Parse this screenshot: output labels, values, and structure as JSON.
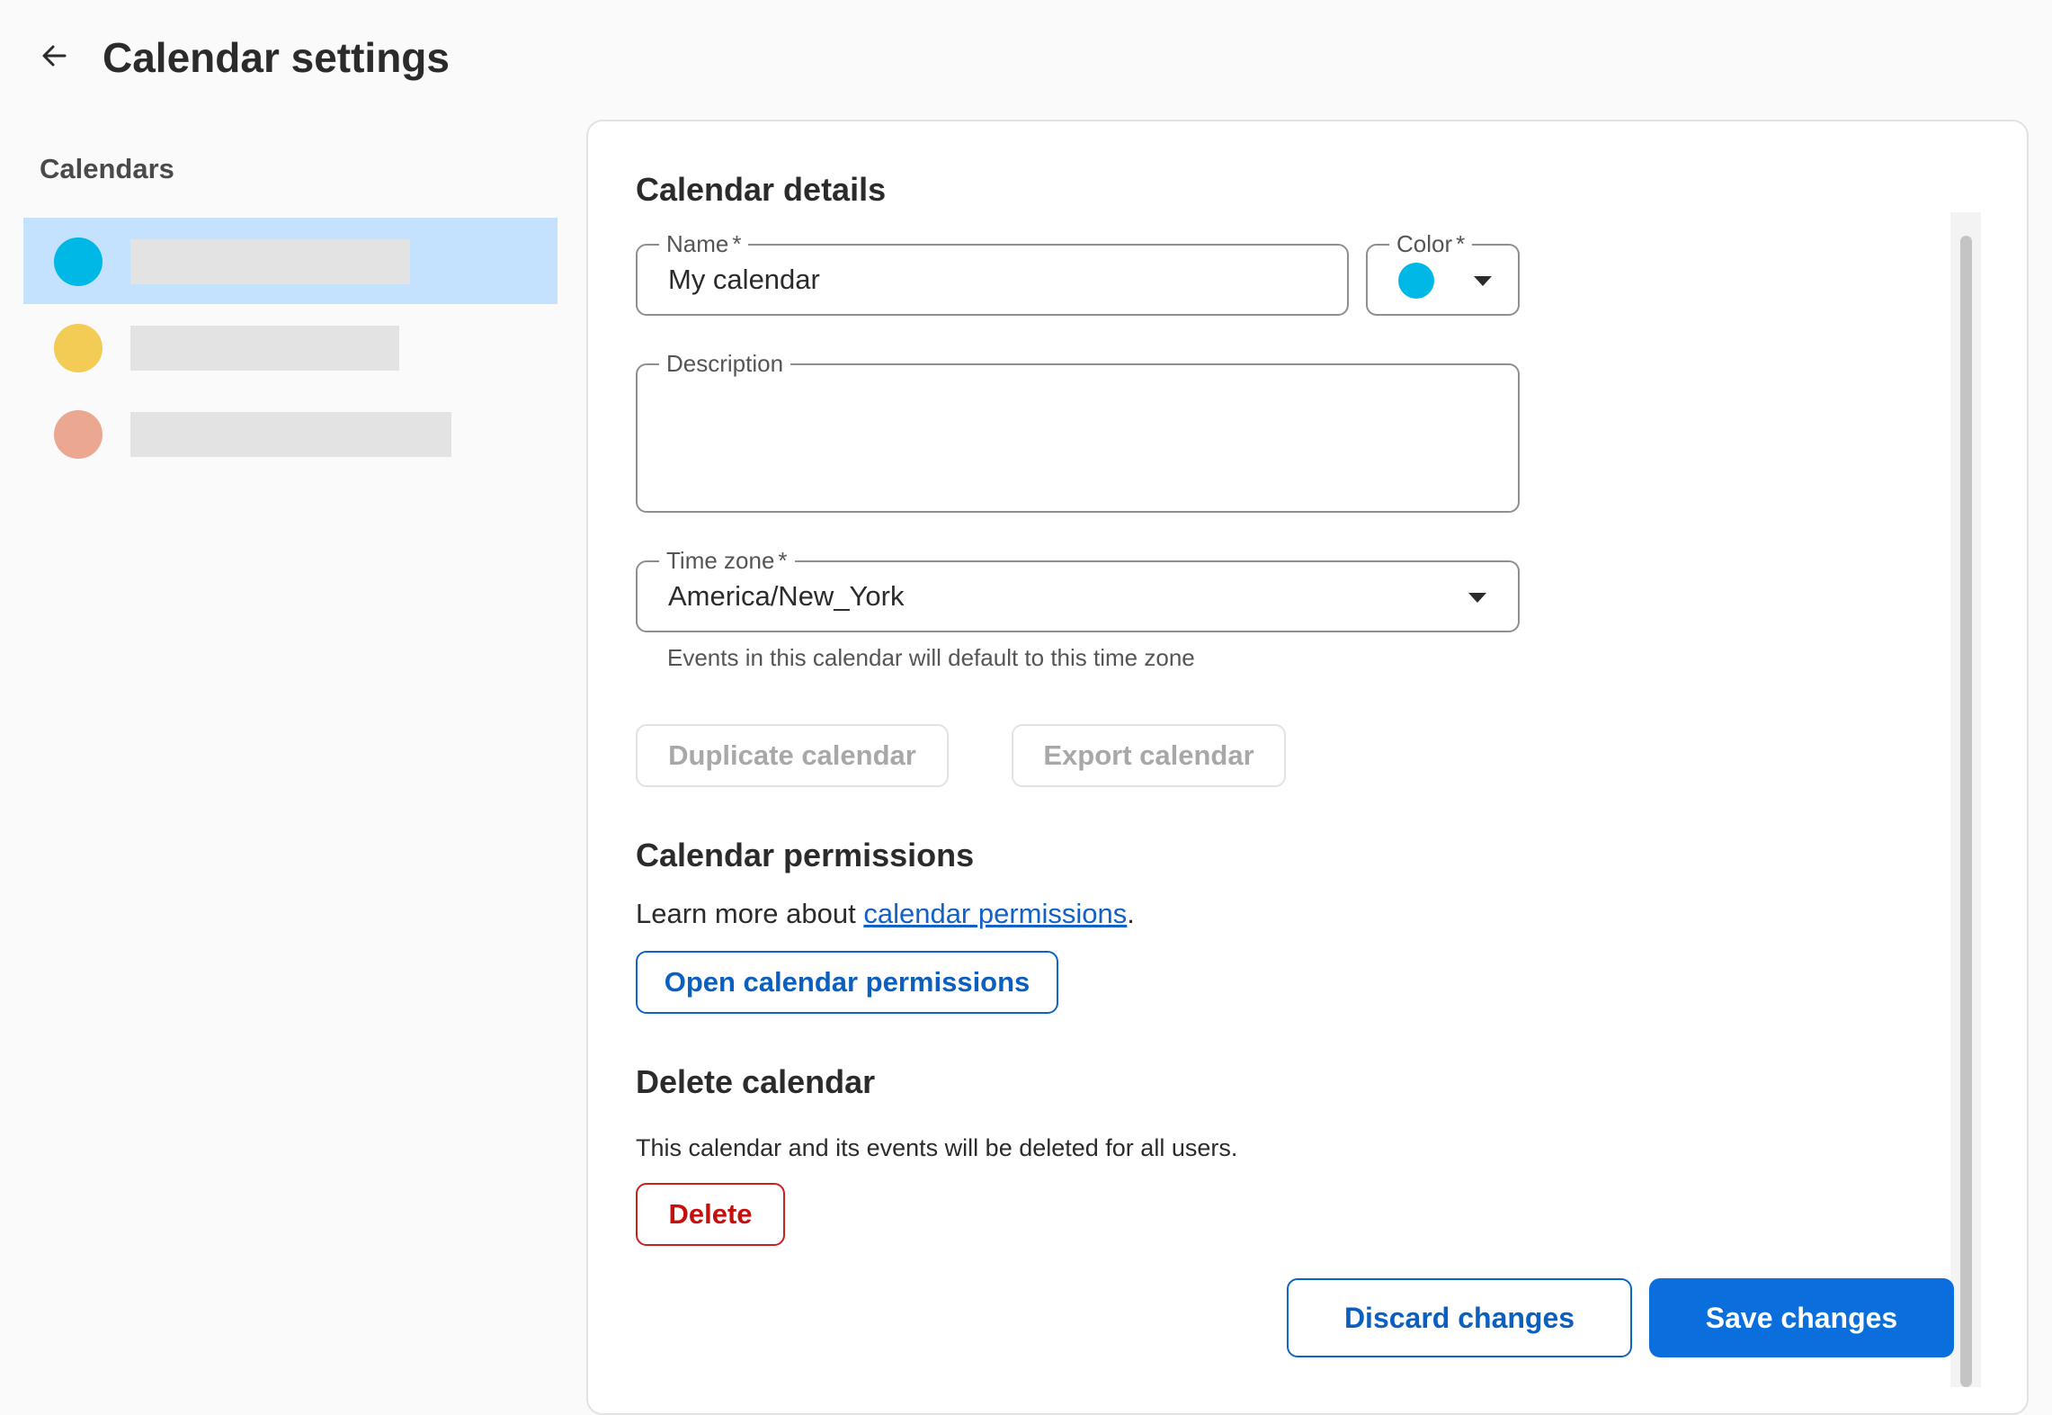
{
  "header": {
    "title": "Calendar settings",
    "back_icon": "arrow-left-icon"
  },
  "sidebar": {
    "heading": "Calendars",
    "items": [
      {
        "color": "#00b8e6",
        "selected": true
      },
      {
        "color": "#f2cc55",
        "selected": false
      },
      {
        "color": "#eba790",
        "selected": false
      }
    ]
  },
  "details": {
    "title": "Calendar details",
    "name_label": "Name",
    "name_value": "My calendar",
    "color_label": "Color",
    "color_value": "#00b8e6",
    "required_marker": "*",
    "description_label": "Description",
    "description_value": "",
    "timezone_label": "Time zone",
    "timezone_value": "America/New_York",
    "timezone_helper": "Events in this calendar will default to this time zone",
    "duplicate_label": "Duplicate calendar",
    "export_label": "Export calendar"
  },
  "permissions": {
    "title": "Calendar permissions",
    "learn_prefix": "Learn more about",
    "learn_link": "calendar permissions",
    "learn_suffix": ".",
    "open_button": "Open calendar permissions"
  },
  "delete": {
    "title": "Delete calendar",
    "description": "This calendar and its events will be deleted for all users.",
    "button": "Delete"
  },
  "footer": {
    "discard_label": "Discard changes",
    "save_label": "Save changes"
  },
  "colors": {
    "accent": "#0a6fdc",
    "danger": "#c60f0f",
    "selected_bg": "#c4e2fe"
  }
}
